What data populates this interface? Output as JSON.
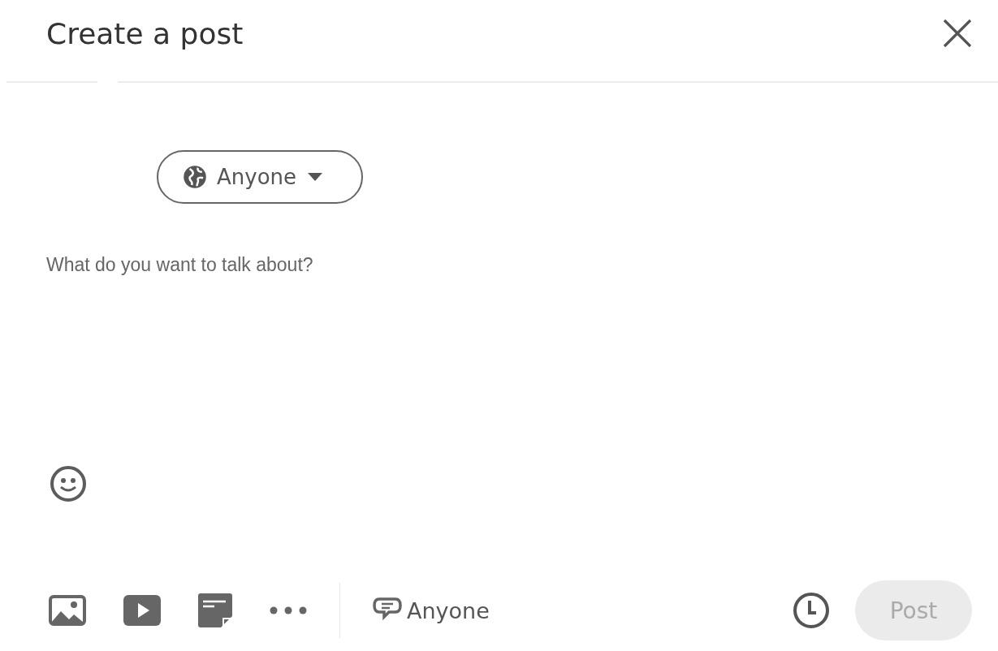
{
  "dialog": {
    "title": "Create a post"
  },
  "visibility": {
    "label": "Anyone"
  },
  "editor": {
    "placeholder": "What do you want to talk about?"
  },
  "toolbar": {
    "comment_setting": "Anyone"
  },
  "post_button": {
    "label": "Post",
    "disabled": true
  }
}
